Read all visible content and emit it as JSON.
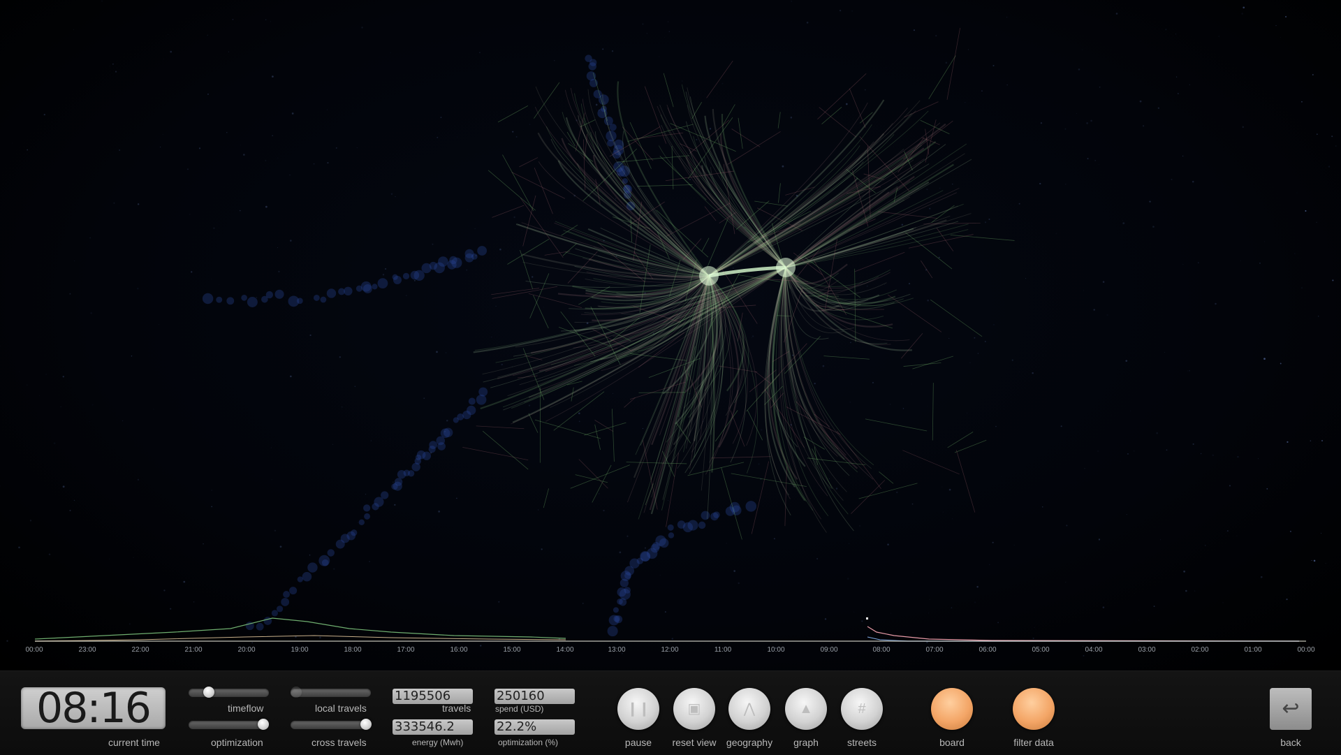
{
  "axis": {
    "ticks_left": [
      "00:00",
      "23:00",
      "22:00",
      "21:00",
      "20:00",
      "19:00",
      "18:00",
      "17:00",
      "16:00",
      "15:00",
      "14:00"
    ],
    "ticks_mid": [
      "13:00",
      "12:00",
      "11:00",
      "10:00",
      "09:00"
    ],
    "ticks_right": [
      "08:00",
      "07:00",
      "06:00",
      "05:00",
      "04:00",
      "03:00",
      "02:00",
      "01:00",
      "00:00"
    ]
  },
  "clock": {
    "time": "08:16",
    "label": "current time"
  },
  "sliders": [
    {
      "label": "timeflow",
      "value": 0.2
    },
    {
      "label": "optimization",
      "value": 0.9
    },
    {
      "label": "local travels",
      "value": 0.05
    },
    {
      "label": "cross travels",
      "value": 0.95
    }
  ],
  "stats": {
    "travels": {
      "value": "1195506",
      "label": "travels"
    },
    "spend": {
      "value": "250160",
      "label": "spend (USD)"
    },
    "energy": {
      "value": "333546.2",
      "label": "energy (Mwh)"
    },
    "optimization": {
      "value": "22.2%",
      "label": "optimization (%)"
    }
  },
  "buttons": {
    "pause": "pause",
    "reset": "reset view",
    "geography": "geography",
    "graph": "graph",
    "streets": "streets",
    "board": "board",
    "filter": "filter data",
    "back": "back"
  },
  "colors": {
    "background": "#000000",
    "bar": "#101010",
    "accent_orange": "#f3a566",
    "flow_green": "#c8f5c0"
  }
}
